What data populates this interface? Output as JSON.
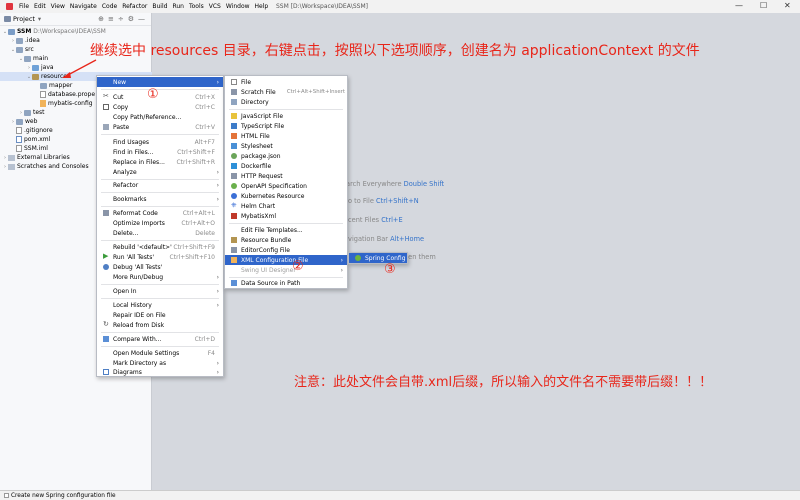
{
  "menubar": {
    "items": [
      "File",
      "Edit",
      "View",
      "Navigate",
      "Code",
      "Refactor",
      "Build",
      "Run",
      "Tools",
      "VCS",
      "Window",
      "Help"
    ],
    "window_title": "SSM [D:\\Workspace\\IDEA\\SSM]",
    "controls": [
      "—",
      "☐",
      "✕"
    ]
  },
  "sidebar": {
    "title": "Project",
    "tree": [
      {
        "label": "SSM",
        "path": "D:\\Workspace\\IDEA\\SSM",
        "icon": "module"
      },
      {
        "label": ".idea",
        "icon": "folder"
      },
      {
        "label": "src",
        "icon": "folder"
      },
      {
        "label": "main",
        "icon": "folder"
      },
      {
        "label": "java",
        "icon": "folder-src"
      },
      {
        "label": "resources",
        "icon": "folder-res"
      },
      {
        "label": "mapper",
        "icon": "folder"
      },
      {
        "label": "database.prope",
        "icon": "file"
      },
      {
        "label": "mybatis-config",
        "icon": "xml"
      },
      {
        "label": "test",
        "icon": "folder"
      },
      {
        "label": "web",
        "icon": "folder"
      },
      {
        "label": ".gitignore",
        "icon": "file"
      },
      {
        "label": "pom.xml",
        "icon": "file"
      },
      {
        "label": "SSM.iml",
        "icon": "file"
      },
      {
        "label": "External Libraries",
        "icon": "lib"
      },
      {
        "label": "Scratches and Consoles",
        "icon": "lib"
      }
    ]
  },
  "hints": [
    {
      "text": "earch Everywhere",
      "key": "Double Shift"
    },
    {
      "text": "o to File",
      "key": "Ctrl+Shift+N"
    },
    {
      "text": "ecent Files",
      "key": "Ctrl+E"
    },
    {
      "text": "avigation Bar",
      "key": "Alt+Home"
    },
    {
      "text": "pen them",
      "key": ""
    }
  ],
  "context_menu": [
    {
      "label": "New",
      "sub": true,
      "highlight": true
    },
    {
      "sep": true
    },
    {
      "label": "Cut",
      "shortcut": "Ctrl+X",
      "icon": "cut-icon"
    },
    {
      "label": "Copy",
      "shortcut": "Ctrl+C",
      "icon": "copy-icon"
    },
    {
      "label": "Copy Path/Reference..."
    },
    {
      "label": "Paste",
      "shortcut": "Ctrl+V",
      "icon": "paste-icon"
    },
    {
      "sep": true
    },
    {
      "label": "Find Usages",
      "shortcut": "Alt+F7"
    },
    {
      "label": "Find in Files...",
      "shortcut": "Ctrl+Shift+F"
    },
    {
      "label": "Replace in Files...",
      "shortcut": "Ctrl+Shift+R"
    },
    {
      "label": "Analyze",
      "sub": true
    },
    {
      "sep": true
    },
    {
      "label": "Refactor",
      "sub": true
    },
    {
      "sep": true
    },
    {
      "label": "Bookmarks",
      "sub": true
    },
    {
      "sep": true
    },
    {
      "label": "Reformat Code",
      "shortcut": "Ctrl+Alt+L",
      "icon": "reformat-icon"
    },
    {
      "label": "Optimize Imports",
      "shortcut": "Ctrl+Alt+O"
    },
    {
      "label": "Delete...",
      "shortcut": "Delete"
    },
    {
      "sep": true
    },
    {
      "label": "Rebuild '<default>'",
      "shortcut": "Ctrl+Shift+F9"
    },
    {
      "label": "Run 'All Tests'",
      "shortcut": "Ctrl+Shift+F10",
      "icon": "run-icon"
    },
    {
      "label": "Debug 'All Tests'",
      "icon": "debug-icon"
    },
    {
      "label": "More Run/Debug",
      "sub": true
    },
    {
      "sep": true
    },
    {
      "label": "Open In",
      "sub": true
    },
    {
      "sep": true
    },
    {
      "label": "Local History",
      "sub": true
    },
    {
      "label": "Repair IDE on File"
    },
    {
      "label": "Reload from Disk",
      "icon": "reload-icon"
    },
    {
      "sep": true
    },
    {
      "label": "Compare With...",
      "shortcut": "Ctrl+D",
      "icon": "compare-icon"
    },
    {
      "sep": true
    },
    {
      "label": "Open Module Settings",
      "shortcut": "F4"
    },
    {
      "label": "Mark Directory as",
      "sub": true
    },
    {
      "label": "Diagrams",
      "sub": true,
      "icon": "diagram-icon"
    }
  ],
  "new_submenu": [
    {
      "label": "File",
      "icon": "file-icon"
    },
    {
      "label": "Scratch File",
      "shortcut": "Ctrl+Alt+Shift+Insert",
      "icon": "scratch-icon"
    },
    {
      "label": "Directory",
      "icon": "folder-icon"
    },
    {
      "sep": true
    },
    {
      "label": "JavaScript File",
      "icon": "js-icon"
    },
    {
      "label": "TypeScript File",
      "icon": "ts-icon"
    },
    {
      "label": "HTML File",
      "icon": "html-icon"
    },
    {
      "label": "Stylesheet",
      "icon": "css-icon"
    },
    {
      "label": "package.json",
      "icon": "npm-icon"
    },
    {
      "label": "Dockerfile",
      "icon": "docker-icon"
    },
    {
      "label": "HTTP Request",
      "icon": "http-icon"
    },
    {
      "label": "OpenAPI Specification",
      "icon": "openapi-icon"
    },
    {
      "label": "Kubernetes Resource",
      "icon": "k8s-icon"
    },
    {
      "label": "Helm Chart",
      "icon": "helm-icon"
    },
    {
      "label": "MybatisXml",
      "icon": "mybatis-icon"
    },
    {
      "sep": true
    },
    {
      "label": "Edit File Templates..."
    },
    {
      "label": "Resource Bundle",
      "icon": "bundle-icon"
    },
    {
      "label": "EditorConfig File",
      "icon": "editorconfig-icon"
    },
    {
      "label": "XML Configuration File",
      "sub": true,
      "highlight": true,
      "icon": "xml-icon"
    },
    {
      "label": "Swing UI Designer",
      "sub": true,
      "disabled": true
    },
    {
      "sep": true
    },
    {
      "label": "Data Source in Path",
      "icon": "datasource-icon"
    }
  ],
  "xml_submenu": [
    {
      "label": "Spring Config",
      "highlight": true,
      "icon": "spring-icon"
    }
  ],
  "annotations": {
    "top": "继续选中 resources 目录，右键点击，按照以下选项顺序，创建名为 applicationContext 的文件",
    "bottom": "注意：此处文件会自带.xml后缀，所以输入的文件名不需要带后缀！！！",
    "steps": [
      "①",
      "②",
      "③"
    ]
  },
  "statusbar": {
    "text": "Create new Spring configuration file"
  },
  "colors": {
    "highlight": "#2f65ca",
    "annotation": "#e8261a",
    "shortcut_key": "#3573c9"
  }
}
